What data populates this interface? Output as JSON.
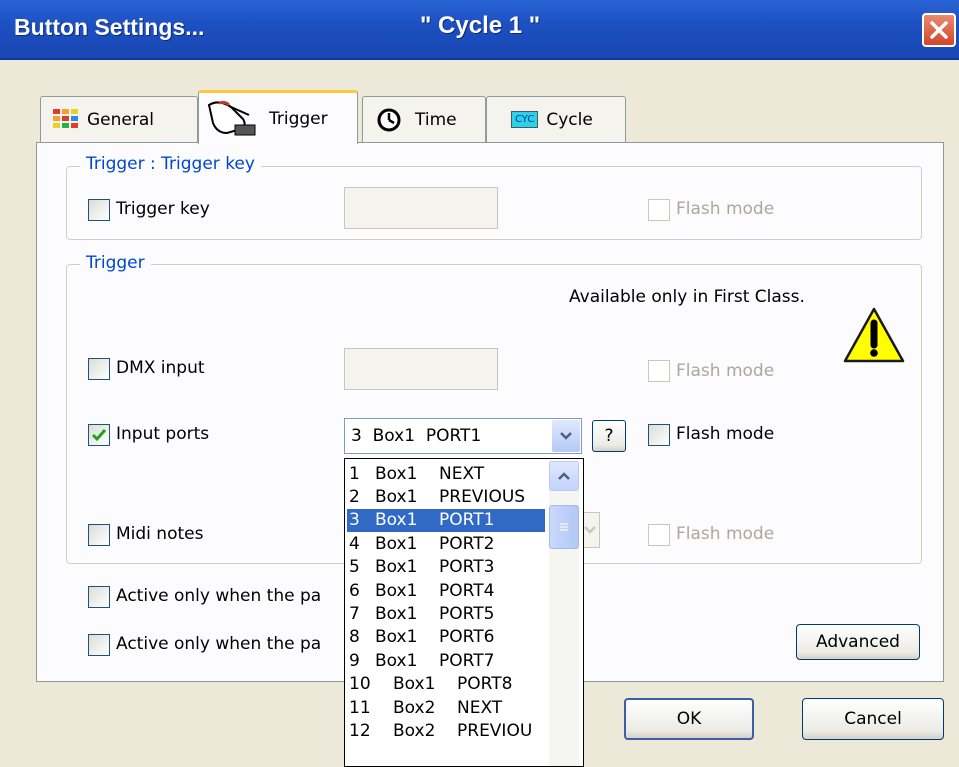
{
  "window": {
    "title": "Button Settings...",
    "subtitle": "\" Cycle 1 \""
  },
  "tabs": [
    {
      "label": "General",
      "icon": "grid-icon",
      "active": false
    },
    {
      "label": "Trigger",
      "icon": "hand-pointer-icon",
      "active": true
    },
    {
      "label": "Time",
      "icon": "clock-icon",
      "active": false
    },
    {
      "label": "Cycle",
      "icon": "cyc-icon",
      "icon_text": "CYC",
      "active": false
    }
  ],
  "trigger_key_group": {
    "legend": "Trigger : Trigger key",
    "checkbox_label": "Trigger key",
    "checked": false,
    "flash_mode_label": "Flash mode"
  },
  "trigger_group": {
    "legend": "Trigger",
    "notice": "Available only in First Class.",
    "dmx": {
      "label": "DMX input",
      "checked": false,
      "flash_label": "Flash mode"
    },
    "input_ports": {
      "label": "Input ports",
      "checked": true,
      "selected_value": "3  Box1  PORT1",
      "help_label": "?",
      "flash_label": "Flash mode"
    },
    "midi": {
      "label": "Midi notes",
      "checked": false,
      "flash_label": "Flash mode"
    }
  },
  "options": {
    "active_1": "Active only when the pa",
    "active_2": "Active only when the pa",
    "advanced_label": "Advanced"
  },
  "dropdown_items": [
    {
      "num": "1",
      "box": "Box1",
      "port": "NEXT"
    },
    {
      "num": "2",
      "box": "Box1",
      "port": "PREVIOUS"
    },
    {
      "num": "3",
      "box": "Box1",
      "port": "PORT1"
    },
    {
      "num": "4",
      "box": "Box1",
      "port": "PORT2"
    },
    {
      "num": "5",
      "box": "Box1",
      "port": "PORT3"
    },
    {
      "num": "6",
      "box": "Box1",
      "port": "PORT4"
    },
    {
      "num": "7",
      "box": "Box1",
      "port": "PORT5"
    },
    {
      "num": "8",
      "box": "Box1",
      "port": "PORT6"
    },
    {
      "num": "9",
      "box": "Box1",
      "port": "PORT7"
    },
    {
      "num": "10",
      "box": "Box1",
      "port": "PORT8"
    },
    {
      "num": "11",
      "box": "Box2",
      "port": "NEXT"
    },
    {
      "num": "12",
      "box": "Box2",
      "port": "PREVIOU"
    }
  ],
  "dropdown_selected_index": 2,
  "footer": {
    "ok_label": "OK",
    "cancel_label": "Cancel"
  },
  "colors": {
    "title_bar": "#1c4fc0",
    "dialog_bg": "#ece9d8",
    "group_label": "#0046d5",
    "selection": "#316ac5",
    "warning": "#ffff00"
  }
}
